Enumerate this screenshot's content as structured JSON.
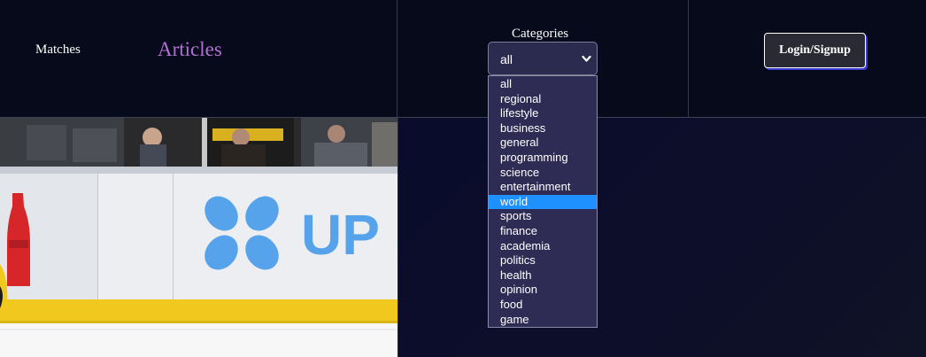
{
  "nav": {
    "matches_label": "Matches",
    "articles_label": "Articles"
  },
  "categories": {
    "label": "Categories",
    "selected_value": "all",
    "highlighted_option": "world",
    "options": [
      "all",
      "regional",
      "lifestyle",
      "business",
      "general",
      "programming",
      "science",
      "entertainment",
      "world",
      "sports",
      "finance",
      "academia",
      "politics",
      "health",
      "opinion",
      "food",
      "game"
    ]
  },
  "auth": {
    "login_label": "Login/Signup"
  },
  "hero_image": {
    "logo_text": "UP",
    "icon": "hockey-rink-photo"
  },
  "colors": {
    "background": "#04081a",
    "articles_accent": "#b46fd4",
    "dropdown_bg": "#2e2b54",
    "highlight": "#1e90ff"
  }
}
